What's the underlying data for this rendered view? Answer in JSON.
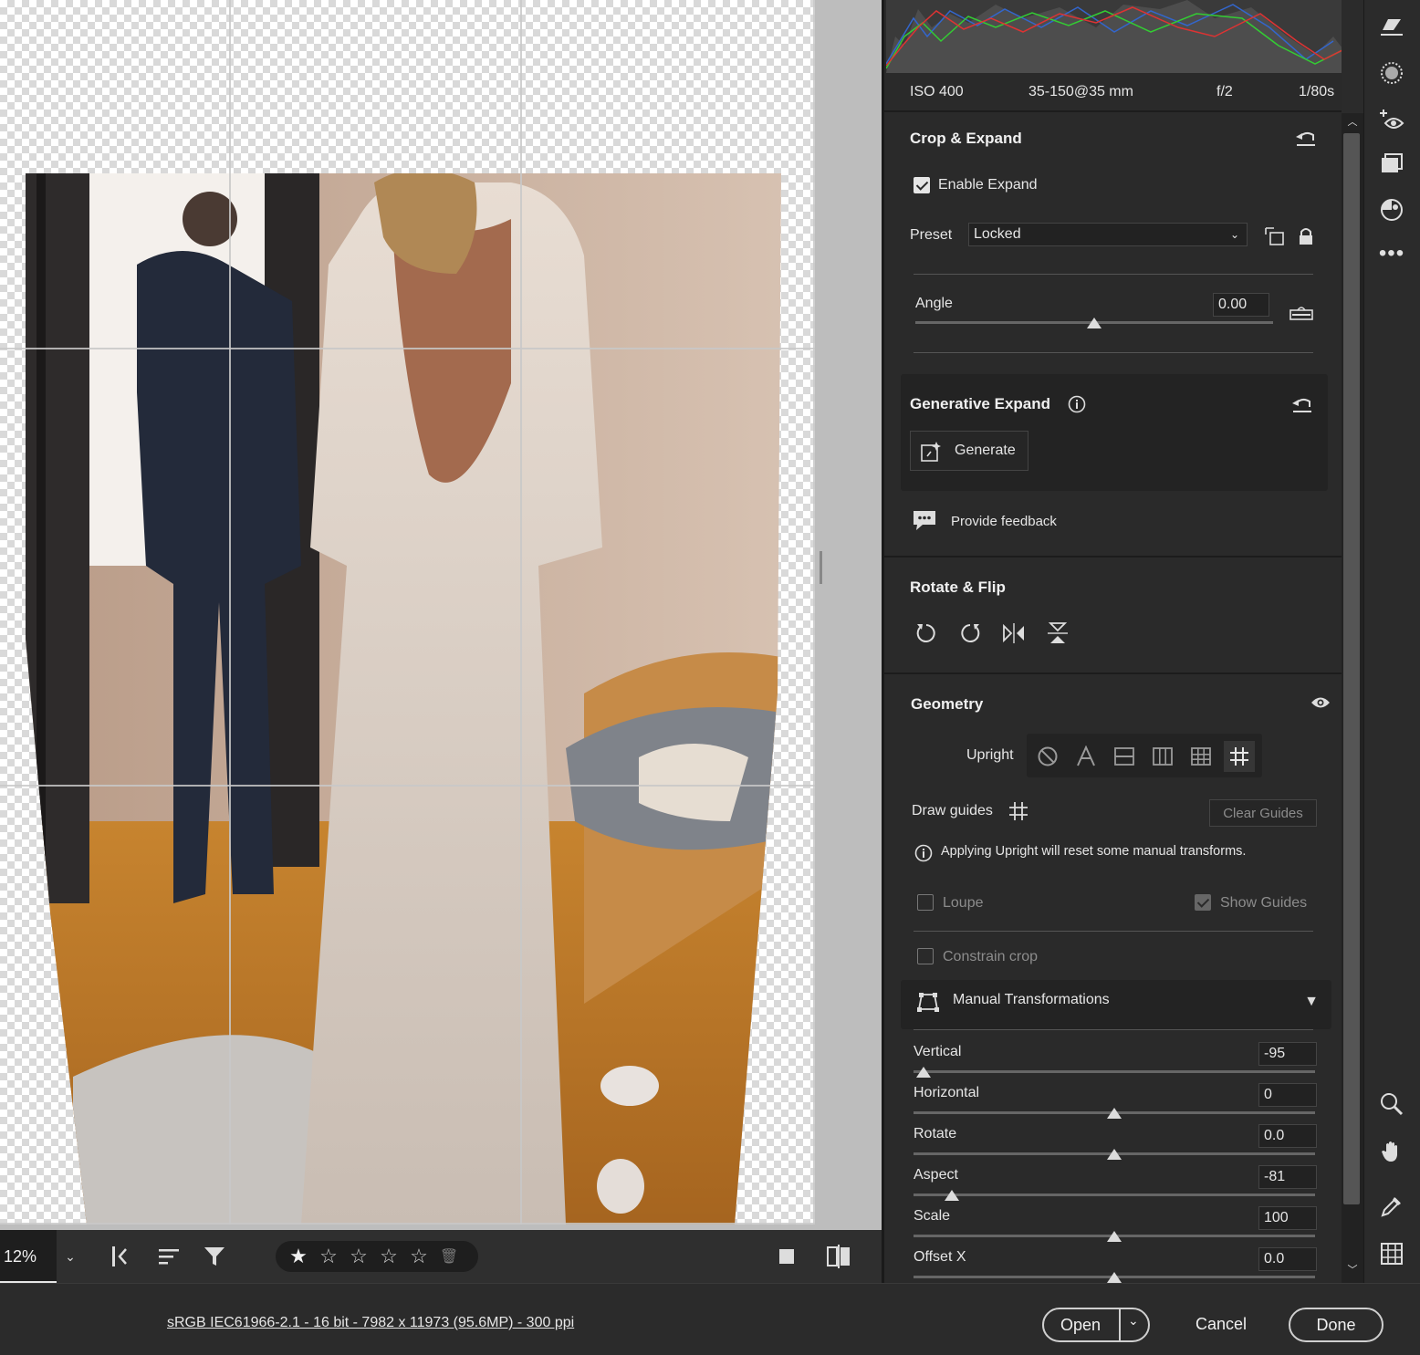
{
  "canvas": {
    "zoom": "12%"
  },
  "toolbar": {
    "ratings": [
      "★",
      "☆",
      "☆",
      "☆",
      "☆"
    ],
    "delete_label": "🗑"
  },
  "footer": {
    "file_info": "sRGB IEC61966-2.1 - 16 bit - 7982 x 11973 (95.6MP) - 300 ppi",
    "open_label": "Open",
    "cancel_label": "Cancel",
    "done_label": "Done"
  },
  "exif": {
    "iso": "ISO 400",
    "lens": "35-150@35 mm",
    "aperture": "f/2",
    "shutter": "1/80s"
  },
  "crop": {
    "title": "Crop & Expand",
    "enable_expand_label": "Enable Expand",
    "enable_expand_checked": true,
    "preset_label": "Preset",
    "preset_value": "Locked",
    "angle_label": "Angle",
    "angle_value": "0.00",
    "angle_level": 0.5
  },
  "generative": {
    "title": "Generative Expand",
    "generate_label": "Generate",
    "feedback_label": "Provide feedback"
  },
  "rotate": {
    "title": "Rotate & Flip"
  },
  "geometry": {
    "title": "Geometry",
    "upright_label": "Upright",
    "draw_guides_label": "Draw guides",
    "clear_guides_label": "Clear Guides",
    "upright_info": "Applying Upright will reset some manual transforms.",
    "loupe_label": "Loupe",
    "show_guides_label": "Show Guides",
    "constrain_label": "Constrain crop",
    "manual_title": "Manual Transformations",
    "sliders": [
      {
        "label": "Vertical",
        "value": "-95",
        "level": 0.025
      },
      {
        "label": "Horizontal",
        "value": "0",
        "level": 0.5
      },
      {
        "label": "Rotate",
        "value": "0.0",
        "level": 0.5
      },
      {
        "label": "Aspect",
        "value": "-81",
        "level": 0.095
      },
      {
        "label": "Scale",
        "value": "100",
        "level": 0.5
      },
      {
        "label": "Offset X",
        "value": "0.0",
        "level": 0.5
      }
    ]
  },
  "icons": {
    "accent": "#e6e6e6"
  }
}
